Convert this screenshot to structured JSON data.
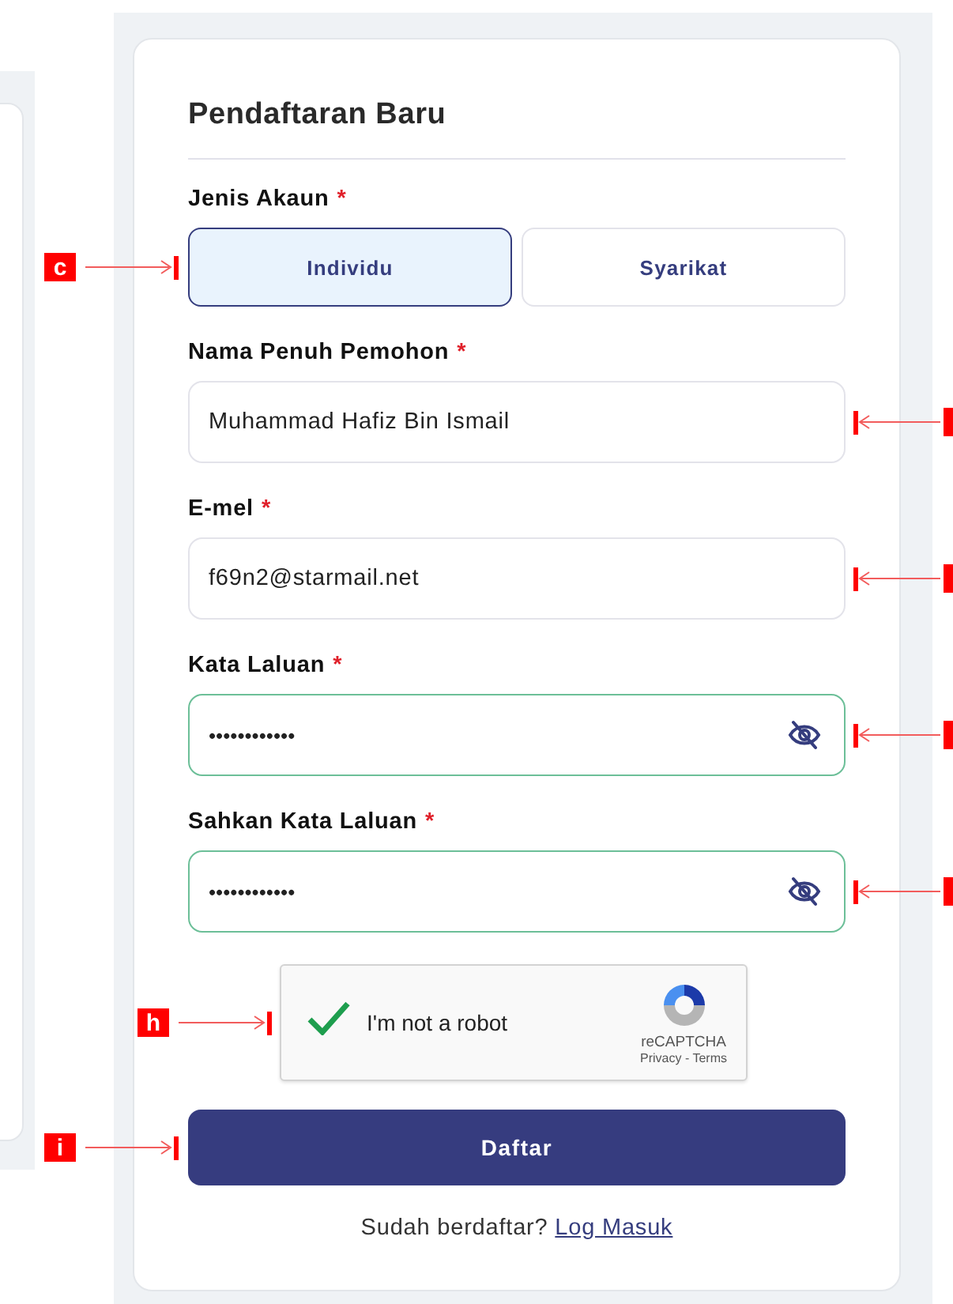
{
  "form": {
    "title": "Pendaftaran Baru",
    "account_type": {
      "label": "Jenis Akaun",
      "required_mark": "*",
      "annotation": "c",
      "options": [
        {
          "label": "Individu",
          "selected": true
        },
        {
          "label": "Syarikat",
          "selected": false
        }
      ]
    },
    "fields": [
      {
        "label": "Nama Penuh Pemohon",
        "required_mark": "*",
        "kind": "text",
        "value": "Muhammad Hafiz Bin Ismail",
        "valid": false,
        "annotation_right": true
      },
      {
        "label": "E-mel",
        "required_mark": "*",
        "kind": "text",
        "value": "f69n2@starmail.net",
        "valid": false,
        "annotation_right": true
      },
      {
        "label": "Kata Laluan",
        "required_mark": "*",
        "kind": "password",
        "value": "••••••••••••",
        "valid": true,
        "annotation_right": true
      },
      {
        "label": "Sahkan Kata Laluan",
        "required_mark": "*",
        "kind": "password",
        "value": "••••••••••••",
        "valid": true,
        "annotation_right": true
      }
    ],
    "captcha": {
      "label": "I'm not a robot",
      "checked": true,
      "brand": "reCAPTCHA",
      "links": "Privacy - Terms",
      "annotation": "h"
    },
    "submit": {
      "label": "Daftar",
      "annotation": "i"
    },
    "footer": {
      "text": "Sudah berdaftar?",
      "link": "Log Masuk"
    }
  }
}
